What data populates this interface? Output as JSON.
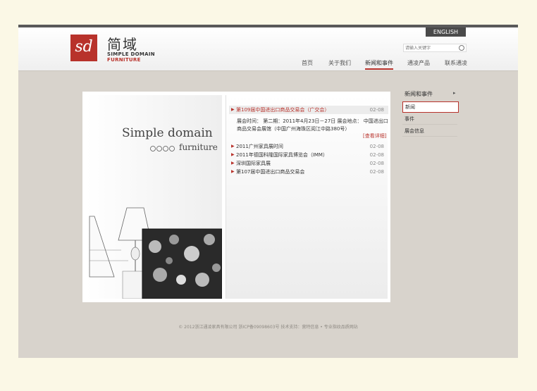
{
  "header": {
    "lang_button": "ENGLISH",
    "logo_mark": "sd",
    "logo_cn": "简域",
    "logo_en_line1": "SIMPLE DOMAIN",
    "logo_en_line2": "FURNITURE",
    "search_placeholder": "请输入关键字"
  },
  "nav": [
    "首页",
    "关于我们",
    "新闻和事件",
    "通凌产品",
    "联系通凌"
  ],
  "nav_active": "新闻和事件",
  "hero": {
    "brand_line1": "Simple domain",
    "brand_line2": "furniture"
  },
  "news": {
    "featured": {
      "title": "第109届中国进出口商品交易会（广交会）",
      "date": "02-08"
    },
    "detail": "展会时间： 第二期：2011年4月23日－27日 展会地点： 中国进出口商品交易会展馆（中国广州海珠区阅江中路380号）",
    "more": "[查看详细]",
    "items": [
      {
        "title": "2011广州家具展时间",
        "date": "02-08"
      },
      {
        "title": "2011年德国科隆国际家具博览会（IMM）",
        "date": "02-08"
      },
      {
        "title": "深圳国际家具展",
        "date": "02-08"
      },
      {
        "title": "第107届中国进出口商品交易会",
        "date": "02-08"
      }
    ]
  },
  "sidebar": {
    "title": "新闻和事件",
    "items": [
      "新闻",
      "事件",
      "展会信息"
    ]
  },
  "footer": {
    "text": "© 2012浙江通凌家具有限公司    浙ICP备09098603号    技术支持：营特信息 • 专业指纹品质网站"
  },
  "colors": {
    "accent": "#b8322b",
    "page_bg": "#d8d3cc"
  }
}
